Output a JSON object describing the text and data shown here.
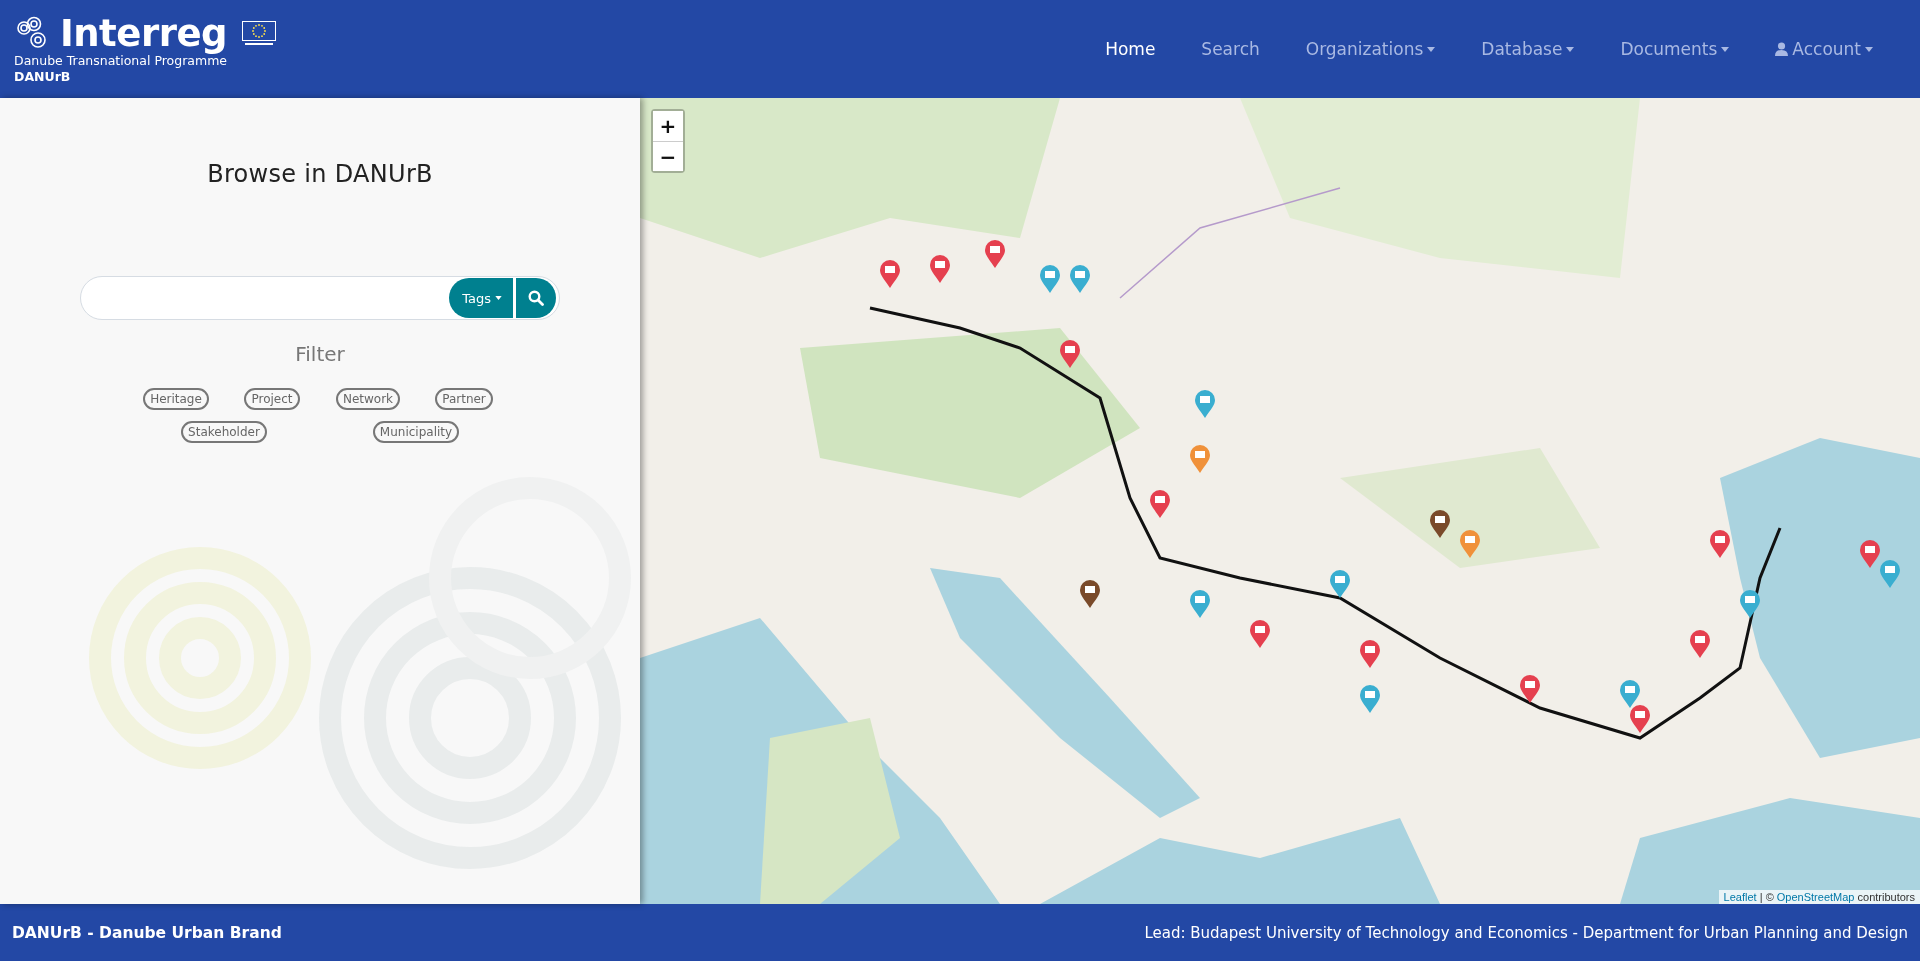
{
  "header": {
    "logo": {
      "name": "Interreg",
      "subtitle": "Danube Transnational Programme",
      "project": "DANUrB"
    },
    "nav": [
      {
        "label": "Home",
        "selected": true,
        "kind": "link"
      },
      {
        "label": "Search",
        "selected": false,
        "kind": "link"
      },
      {
        "label": "Organizations",
        "selected": false,
        "kind": "dropdown"
      },
      {
        "label": "Database",
        "selected": false,
        "kind": "dropdown"
      },
      {
        "label": "Documents",
        "selected": false,
        "kind": "dropdown"
      },
      {
        "label": "Account",
        "selected": false,
        "kind": "user"
      }
    ]
  },
  "sidebar": {
    "title": "Browse in DANUrB",
    "search": {
      "tags_button": "Tags"
    },
    "filter_title": "Filter",
    "filters": [
      "Heritage",
      "Project",
      "Network",
      "Partner",
      "Stakeholder",
      "Municipality"
    ]
  },
  "map": {
    "zoom_in": "+",
    "zoom_out": "−",
    "attribution": {
      "leaflet": "Leaflet",
      "separator": "|",
      "copyright": "©",
      "osm": "OpenStreetMap",
      "suffix": "contributors"
    }
  },
  "footer": {
    "left": "DANUrB - Danube Urban Brand",
    "right": "Lead: Budapest University of Technology and Economics - Department for Urban Planning and Design"
  }
}
